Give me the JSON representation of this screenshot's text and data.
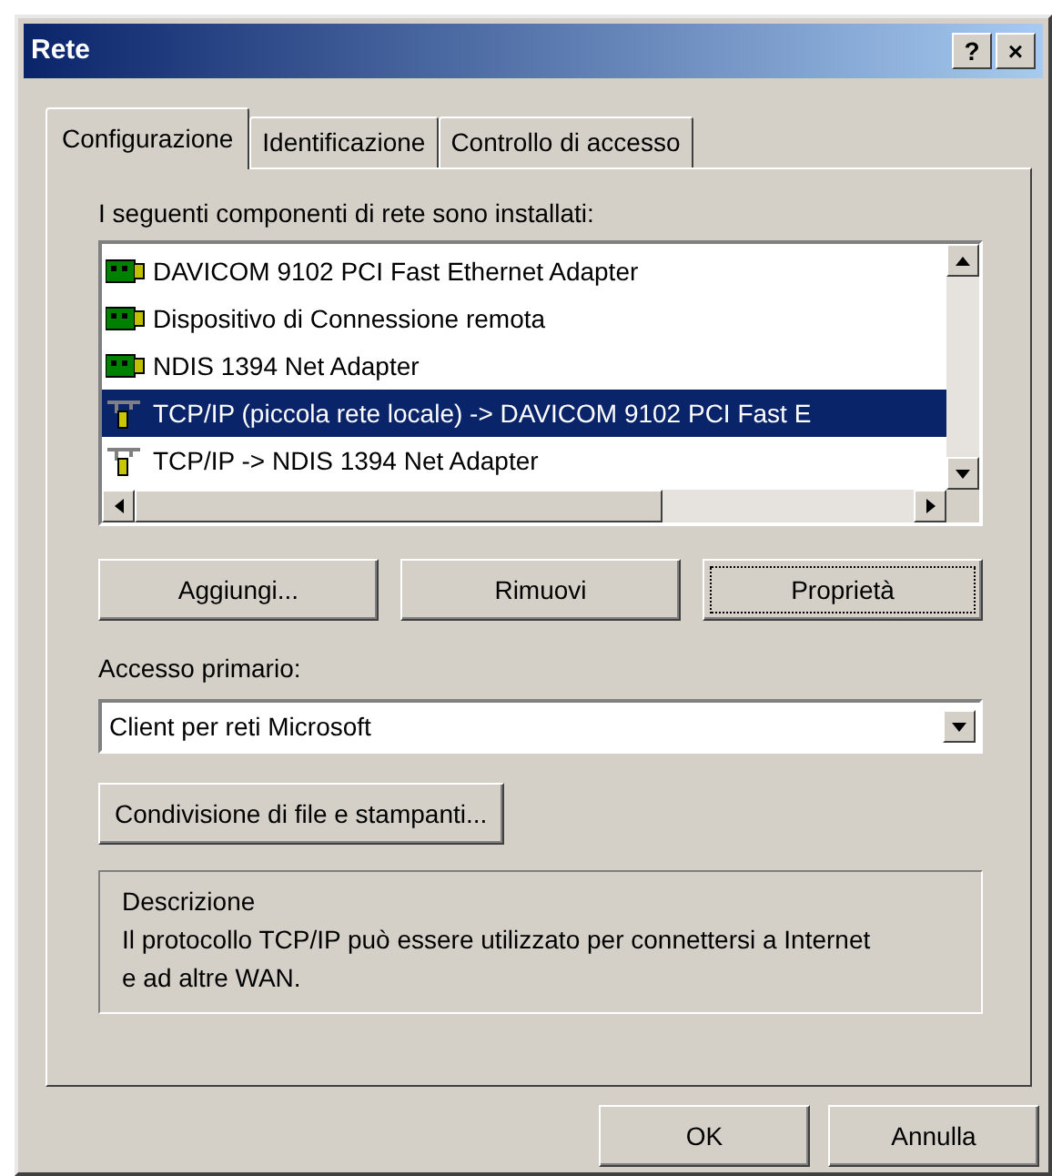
{
  "window": {
    "title": "Rete",
    "help_button": "?",
    "close_button": "×"
  },
  "tabs": [
    {
      "label": "Configurazione",
      "selected": true
    },
    {
      "label": "Identificazione",
      "selected": false
    },
    {
      "label": "Controllo di accesso",
      "selected": false
    }
  ],
  "components_label": "I seguenti componenti di rete sono installati:",
  "components": [
    {
      "kind": "adapter",
      "name": "DAVICOM 9102 PCI Fast Ethernet Adapter",
      "selected": false
    },
    {
      "kind": "adapter",
      "name": "Dispositivo di Connessione remota",
      "selected": false
    },
    {
      "kind": "adapter",
      "name": "NDIS 1394 Net Adapter",
      "selected": false
    },
    {
      "kind": "protocol",
      "name": "TCP/IP (piccola rete locale) -> DAVICOM 9102 PCI Fast E",
      "selected": true
    },
    {
      "kind": "protocol",
      "name": "TCP/IP -> NDIS 1394 Net Adapter",
      "selected": false
    }
  ],
  "component_buttons": [
    {
      "label": "Aggiungi...",
      "focused": false
    },
    {
      "label": "Rimuovi",
      "focused": false
    },
    {
      "label": "Proprietà",
      "focused": true
    }
  ],
  "primary_access": {
    "label": "Accesso primario:",
    "value": "Client per reti Microsoft"
  },
  "sharing_button": "Condivisione di file e stampanti...",
  "description": {
    "title": "Descrizione",
    "text": "Il protocollo TCP/IP può essere utilizzato per connettersi a Internet e ad altre WAN."
  },
  "footer_buttons": [
    "OK",
    "Annulla"
  ]
}
